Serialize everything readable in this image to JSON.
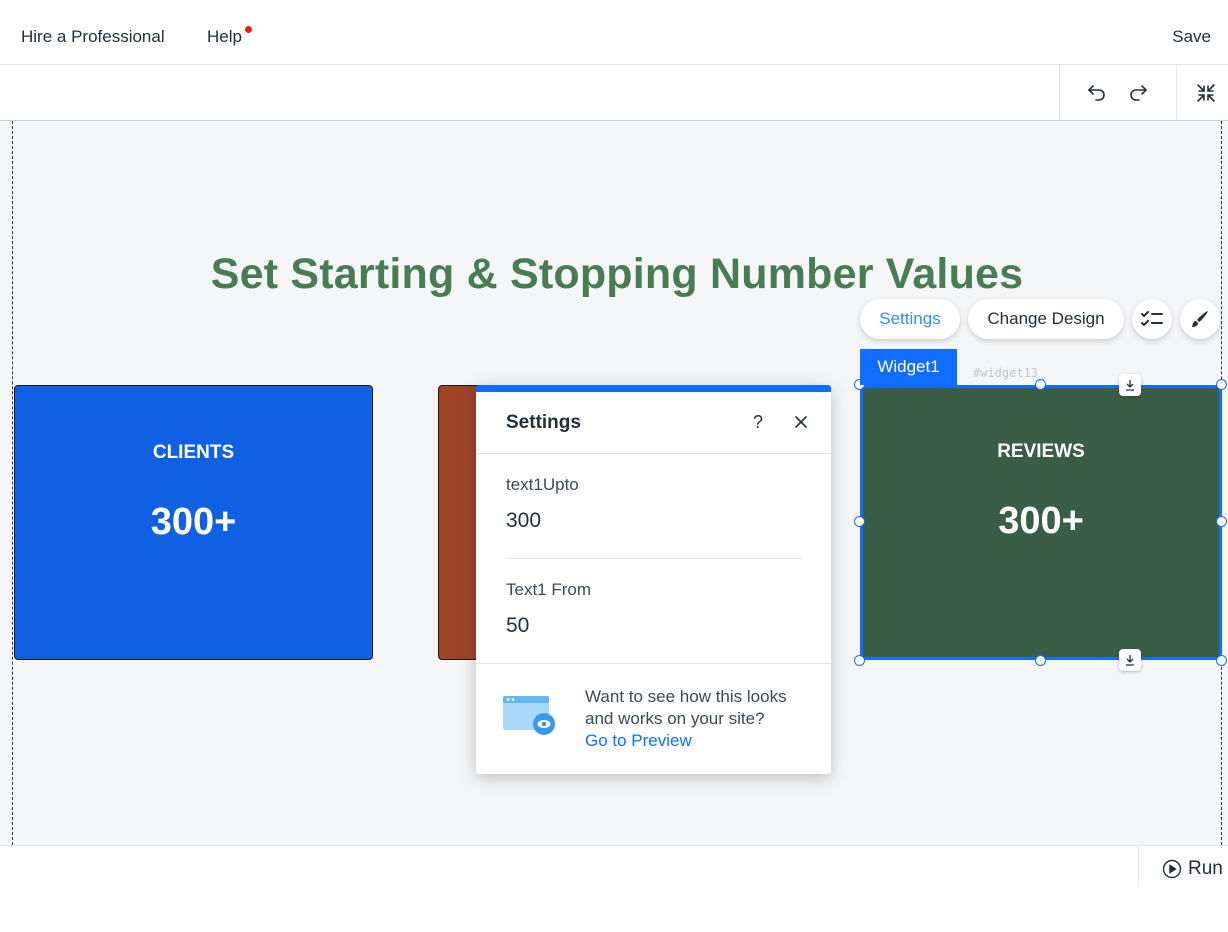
{
  "topbar": {
    "hire_label": "Hire a Professional",
    "help_label": "Help",
    "save_label": "Save"
  },
  "toolbar": {
    "undo_icon": "undo-icon",
    "redo_icon": "redo-icon",
    "collapse_icon": "collapse-icon"
  },
  "canvas": {
    "headline": "Set Starting & Stopping Number Values",
    "cards": [
      {
        "label": "CLIENTS",
        "value": "300+",
        "color": "#1060e3"
      },
      {
        "label": "",
        "value": "",
        "color": "#a04428"
      },
      {
        "label": "REVIEWS",
        "value": "300+",
        "color": "#3a5e45"
      }
    ],
    "selection": {
      "widget_name": "Widget1",
      "widget_id": "#widget13",
      "settings_label": "Settings",
      "change_design_label": "Change Design"
    }
  },
  "settings_panel": {
    "title": "Settings",
    "help_glyph": "?",
    "fields": [
      {
        "label": "text1Upto",
        "value": "300"
      },
      {
        "label": "Text1 From",
        "value": "50"
      }
    ],
    "promo_text": "Want to see how this looks and works on your site?",
    "promo_link": "Go to Preview"
  },
  "bottombar": {
    "run_label": "Run"
  },
  "colors": {
    "accent": "#116dff",
    "headline": "#487d54"
  }
}
